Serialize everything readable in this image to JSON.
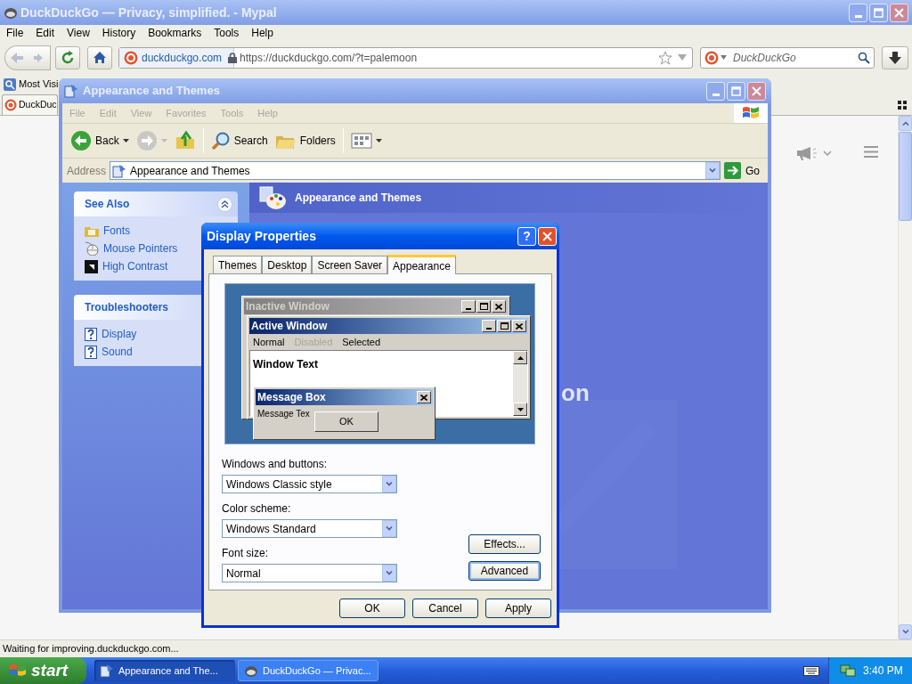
{
  "browser": {
    "title": "DuckDuckGo — Privacy, simplified. - Mypal",
    "menu": [
      "File",
      "Edit",
      "View",
      "History",
      "Bookmarks",
      "Tools",
      "Help"
    ],
    "site_identity": "duckduckgo.com",
    "url": "https://duckduckgo.com/?t=palemoon",
    "search_placeholder": "DuckDuckGo",
    "bookmarks": [
      "Most Visi"
    ],
    "tabs": [
      {
        "label": "DuckDuc",
        "selected": true
      }
    ],
    "status": "Waiting for improving.duckduckgo.com..."
  },
  "explorer": {
    "title": "Appearance and Themes",
    "menu": [
      "File",
      "Edit",
      "View",
      "Favorites",
      "Tools",
      "Help"
    ],
    "toolbar": [
      {
        "kind": "back",
        "label": "Back"
      },
      {
        "kind": "forward"
      },
      {
        "kind": "up"
      },
      {
        "kind": "search",
        "label": "Search"
      },
      {
        "kind": "folders",
        "label": "Folders"
      },
      {
        "kind": "views"
      }
    ],
    "address_label": "Address",
    "address": "Appearance and Themes",
    "go": "Go",
    "panels": [
      {
        "title": "See Also",
        "items": [
          {
            "kind": "fonts",
            "label": "Fonts"
          },
          {
            "kind": "mouse",
            "label": "Mouse Pointers"
          },
          {
            "kind": "contrast",
            "label": "High Contrast"
          }
        ]
      },
      {
        "title": "Troubleshooters",
        "items": [
          {
            "kind": "help",
            "label": "Display"
          },
          {
            "kind": "help",
            "label": "Sound"
          }
        ]
      }
    ],
    "heading": "Appearance and Themes",
    "backdrop_text": "on"
  },
  "dialog": {
    "title": "Display Properties",
    "help": "?",
    "tabs": [
      {
        "label": "Themes",
        "selected": false
      },
      {
        "label": "Desktop",
        "selected": false
      },
      {
        "label": "Screen Saver",
        "selected": false
      },
      {
        "label": "Appearance",
        "selected": true
      }
    ],
    "preview": {
      "inactive_title": "Inactive Window",
      "active_title": "Active Window",
      "menu": [
        {
          "label": "Normal",
          "disabled": false
        },
        {
          "label": "Disabled",
          "disabled": true
        },
        {
          "label": "Selected",
          "disabled": false
        }
      ],
      "window_text": "Window Text",
      "message_title": "Message Box",
      "message_text": "Message Tex",
      "ok": "OK"
    },
    "fields": [
      {
        "label": "Windows and buttons:",
        "value": "Windows Classic style"
      },
      {
        "label": "Color scheme:",
        "value": "Windows Standard"
      },
      {
        "label": "Font size:",
        "value": "Normal"
      }
    ],
    "side_buttons": [
      {
        "label": "Effects...",
        "focused": false
      },
      {
        "label": "Advanced",
        "focused": true
      }
    ],
    "buttons": [
      "OK",
      "Cancel",
      "Apply"
    ]
  },
  "taskbar": {
    "start": "start",
    "tasks": [
      {
        "kind": "explorer",
        "label": "Appearance and The...",
        "selected": true
      },
      {
        "kind": "browser",
        "label": "DuckDuckGo — Privac...",
        "selected": false
      }
    ],
    "clock": "3:40 PM"
  }
}
